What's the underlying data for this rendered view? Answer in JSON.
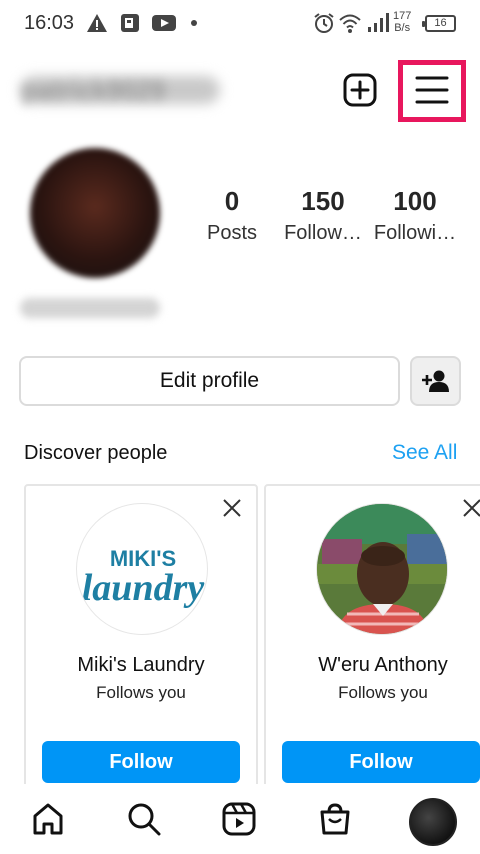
{
  "status_bar": {
    "time": "16:03",
    "net_speed_value": "177",
    "net_speed_unit": "B/s",
    "battery": "16"
  },
  "header": {
    "username": "patrick9029",
    "icons": [
      "new-post-icon",
      "menu-icon"
    ]
  },
  "profile": {
    "full_name": "Patrick Kariuki",
    "stats": [
      {
        "value": "0",
        "label": "Posts"
      },
      {
        "value": "150",
        "label": "Follow…"
      },
      {
        "value": "100",
        "label": "Followi…"
      }
    ],
    "edit_label": "Edit profile"
  },
  "discover": {
    "title": "Discover people",
    "see_all": "See All",
    "cards": [
      {
        "name": "Miki's Laundry",
        "subtitle": "Follows you",
        "button": "Follow",
        "logo_top": "MIKI'S",
        "logo_bottom": "laundry"
      },
      {
        "name": "W'eru Anthony",
        "subtitle": "Follows you",
        "button": "Follow"
      }
    ]
  },
  "bottom_nav": {
    "items": [
      "home-icon",
      "search-icon",
      "reels-icon",
      "shop-icon",
      "profile-avatar"
    ]
  },
  "colors": {
    "accent": "#0095f6",
    "link": "#1da1f2",
    "highlight": "#e8175d"
  }
}
